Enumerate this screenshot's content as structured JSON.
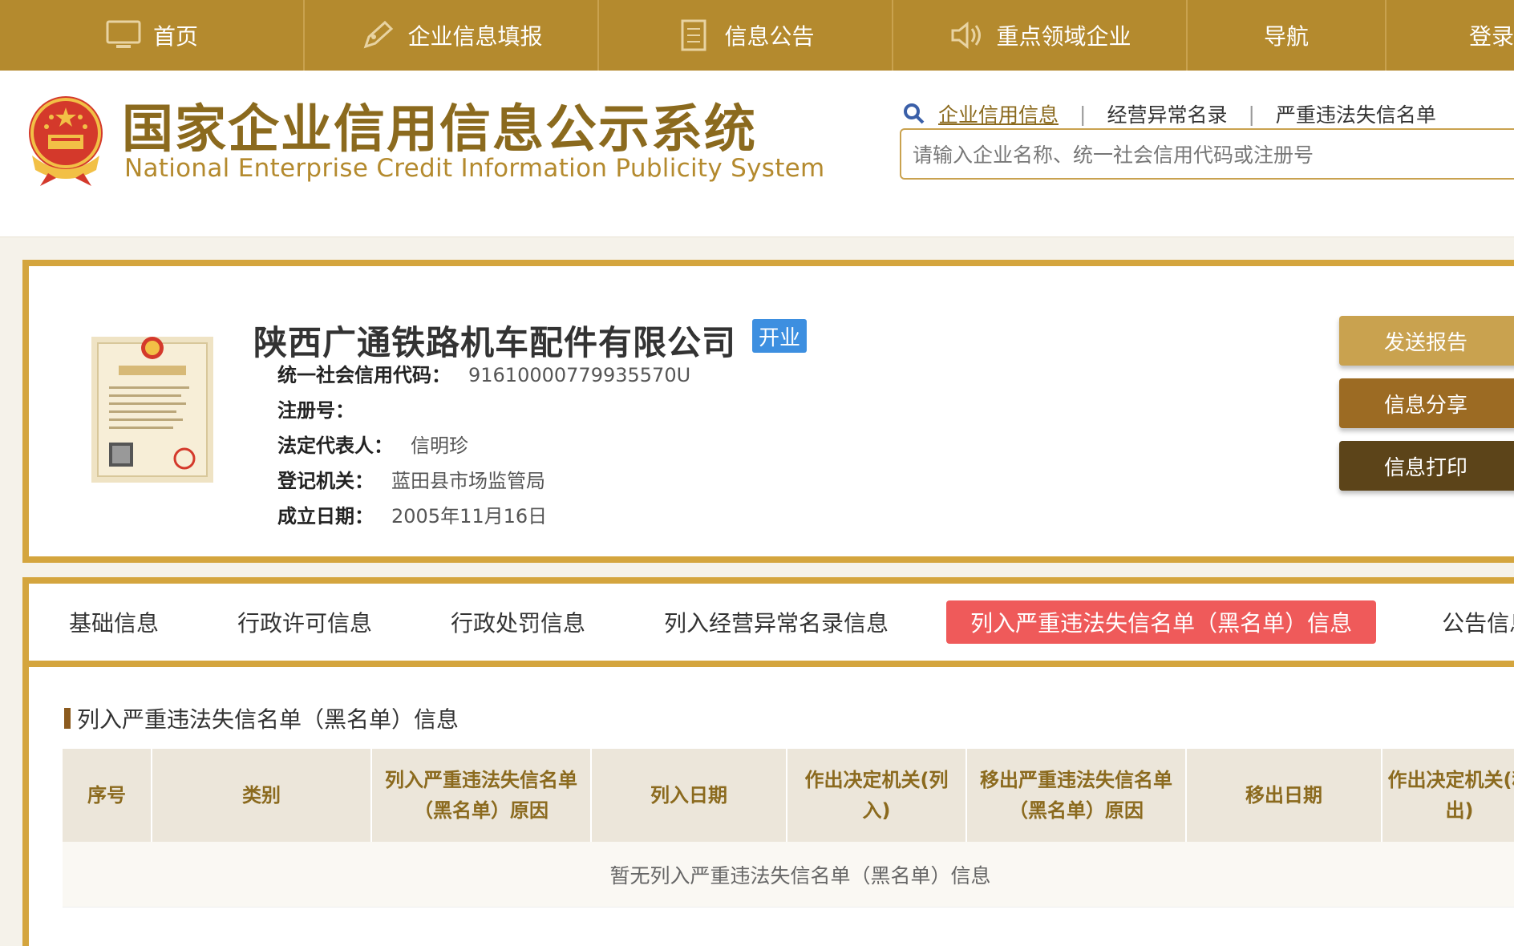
{
  "nav": {
    "items": [
      {
        "label": "首页",
        "icon": "monitor-icon"
      },
      {
        "label": "企业信息填报",
        "icon": "pen-icon"
      },
      {
        "label": "信息公告",
        "icon": "document-icon"
      },
      {
        "label": "重点领域企业",
        "icon": "speaker-icon"
      },
      {
        "label": "导航"
      },
      {
        "label": "登录"
      }
    ]
  },
  "header": {
    "title": "国家企业信用信息公示系统",
    "subtitle": "National Enterprise Credit Information Publicity System",
    "search_tabs": [
      "企业信用信息",
      "经营异常名录",
      "严重违法失信名单"
    ],
    "search_placeholder": "请输入企业名称、统一社会信用代码或注册号"
  },
  "company": {
    "name": "陕西广通铁路机车配件有限公司",
    "status": "开业",
    "fields": [
      {
        "label": "统一社会信用代码：",
        "value": "91610000779935570U"
      },
      {
        "label": "注册号：",
        "value": ""
      },
      {
        "label": "法定代表人：",
        "value": "信明珍"
      },
      {
        "label": "登记机关：",
        "value": "蓝田县市场监管局"
      },
      {
        "label": "成立日期：",
        "value": "2005年11月16日"
      }
    ],
    "buttons": {
      "report": "发送报告",
      "share": "信息分享",
      "print": "信息打印"
    }
  },
  "tabs": [
    "基础信息",
    "行政许可信息",
    "行政处罚信息",
    "列入经营异常名录信息",
    "列入严重违法失信名单（黑名单）信息",
    "公告信息"
  ],
  "section": {
    "title": "列入严重违法失信名单（黑名单）信息",
    "columns": [
      "序号",
      "类别",
      "列入严重违法失信名单（黑名单）原因",
      "列入日期",
      "作出决定机关(列入)",
      "移出严重违法失信名单（黑名单）原因",
      "移出日期",
      "作出决定机关(移出)"
    ],
    "empty_text": "暂无列入严重违法失信名单（黑名单）信息"
  },
  "colors": {
    "brand": "#b48a2e",
    "border": "#d4a53e",
    "active_tab": "#ef5a5a",
    "badge": "#3d8fe0"
  }
}
